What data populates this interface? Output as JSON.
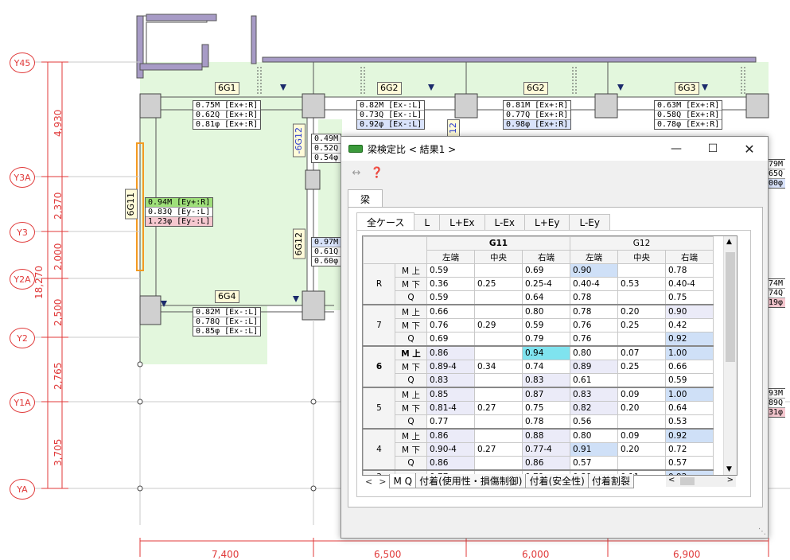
{
  "plan": {
    "grid_y": [
      {
        "label": "Y45"
      },
      {
        "label": "Y3A"
      },
      {
        "label": "Y3"
      },
      {
        "label": "Y2A"
      },
      {
        "label": "Y2"
      },
      {
        "label": "Y1A"
      },
      {
        "label": "YA"
      }
    ],
    "dims_vertical": [
      "4,930",
      "2,370",
      "2,000",
      "2,500",
      "2,765",
      "3,705"
    ],
    "dim_total": "18,270",
    "dims_horizontal": [
      "7,400",
      "6,500",
      "6,000",
      "6,900"
    ],
    "beam_tags": [
      "6G1",
      "6G2",
      "6G2",
      "6G3",
      "6G4"
    ],
    "beam_tags_vertical": [
      "6G11",
      "-6G12",
      "6G12",
      "12"
    ],
    "ratio_boxes": [
      [
        "0.75M [Ex+:R]",
        "0.62Q [Ex+:R]",
        "0.81φ [Ex+:R]"
      ],
      [
        "0.82M [Ex-:L]",
        "0.73Q [Ex-:L]",
        "0.92φ [Ex-:L]"
      ],
      [
        "0.81M [Ex+:R]",
        "0.77Q [Ex+:R]",
        "0.98φ [Ex+:R]"
      ],
      [
        "0.63M [Ex+:R]",
        "0.58Q [Ex+:R]",
        "0.78φ [Ex+:R]"
      ],
      [
        "0.49M",
        "0.52Q",
        "0.54φ"
      ],
      [
        "0.94M [Ey+:R]",
        "0.83Q [Ey-:L]",
        "1.23φ [Ey-:L]"
      ],
      [
        "0.97M",
        "0.61Q",
        "0.60φ"
      ],
      [
        "0.82M [Ex-:L]",
        "0.78Q [Ex-:L]",
        "0.85φ [Ex-:L]"
      ]
    ],
    "right_edge_texts": [
      "79M",
      "65Q",
      "00φ",
      "74M",
      "74Q",
      "19φ",
      "93M",
      "89Q",
      "31φ"
    ]
  },
  "window": {
    "title": "梁検定比 < 結果1 >",
    "outer_tab": "梁",
    "case_tabs": [
      "全ケース",
      "L",
      "L+Ex",
      "L-Ex",
      "L+Ey",
      "L-Ey"
    ],
    "sheet_tabs": [
      "M Q",
      "付着(使用性・損傷制御)",
      "付着(安全性)",
      "付着割裂"
    ],
    "groups": [
      "G11",
      "G12"
    ],
    "subheaders": [
      "左端",
      "中央",
      "右端",
      "左端",
      "中央",
      "右端"
    ],
    "rows": [
      {
        "floor": "R",
        "bold": false,
        "items": [
          {
            "label": "M 上",
            "vals": [
              "0.59",
              "",
              "0.69",
              "0.90",
              "",
              "0.78"
            ]
          },
          {
            "label": "M 下",
            "vals": [
              "0.36",
              "0.25",
              "0.25-4",
              "0.40-4",
              "0.53",
              "0.40-4"
            ]
          },
          {
            "label": "Q",
            "vals": [
              "0.59",
              "",
              "0.64",
              "0.78",
              "",
              "0.75"
            ]
          }
        ]
      },
      {
        "floor": "7",
        "bold": false,
        "items": [
          {
            "label": "M 上",
            "vals": [
              "0.66",
              "",
              "0.80",
              "0.78",
              "0.20",
              "0.90"
            ]
          },
          {
            "label": "M 下",
            "vals": [
              "0.76",
              "0.29",
              "0.59",
              "0.76",
              "0.25",
              "0.42"
            ]
          },
          {
            "label": "Q",
            "vals": [
              "0.69",
              "",
              "0.79",
              "0.76",
              "",
              "0.92"
            ]
          }
        ]
      },
      {
        "floor": "6",
        "bold": true,
        "items": [
          {
            "label": "M 上",
            "vals": [
              "0.86",
              "",
              "0.94",
              "0.80",
              "0.07",
              "1.00"
            ]
          },
          {
            "label": "M 下",
            "vals": [
              "0.89-4",
              "0.34",
              "0.74",
              "0.89",
              "0.25",
              "0.66"
            ]
          },
          {
            "label": "Q",
            "vals": [
              "0.83",
              "",
              "0.83",
              "0.61",
              "",
              "0.59"
            ]
          }
        ]
      },
      {
        "floor": "5",
        "bold": false,
        "items": [
          {
            "label": "M 上",
            "vals": [
              "0.85",
              "",
              "0.87",
              "0.83",
              "0.09",
              "1.00"
            ]
          },
          {
            "label": "M 下",
            "vals": [
              "0.81-4",
              "0.27",
              "0.75",
              "0.82",
              "0.20",
              "0.64"
            ]
          },
          {
            "label": "Q",
            "vals": [
              "0.77",
              "",
              "0.78",
              "0.56",
              "",
              "0.53"
            ]
          }
        ]
      },
      {
        "floor": "4",
        "bold": false,
        "items": [
          {
            "label": "M 上",
            "vals": [
              "0.86",
              "",
              "0.88",
              "0.80",
              "0.09",
              "0.92"
            ]
          },
          {
            "label": "M 下",
            "vals": [
              "0.90-4",
              "0.27",
              "0.77-4",
              "0.91",
              "0.20",
              "0.72"
            ]
          },
          {
            "label": "Q",
            "vals": [
              "0.86",
              "",
              "0.86",
              "0.57",
              "",
              "0.57"
            ]
          }
        ]
      },
      {
        "floor": "3",
        "bold": false,
        "items": [
          {
            "label": "M 上",
            "vals": [
              "0.77",
              "",
              "0.79",
              "0.80",
              "0.11",
              "0.92"
            ]
          }
        ]
      }
    ],
    "colors": {
      "highlight_lavender": "#ebebf8",
      "highlight_blue": "#cfe0f7",
      "highlight_cyan": "#7fe3ef"
    }
  }
}
